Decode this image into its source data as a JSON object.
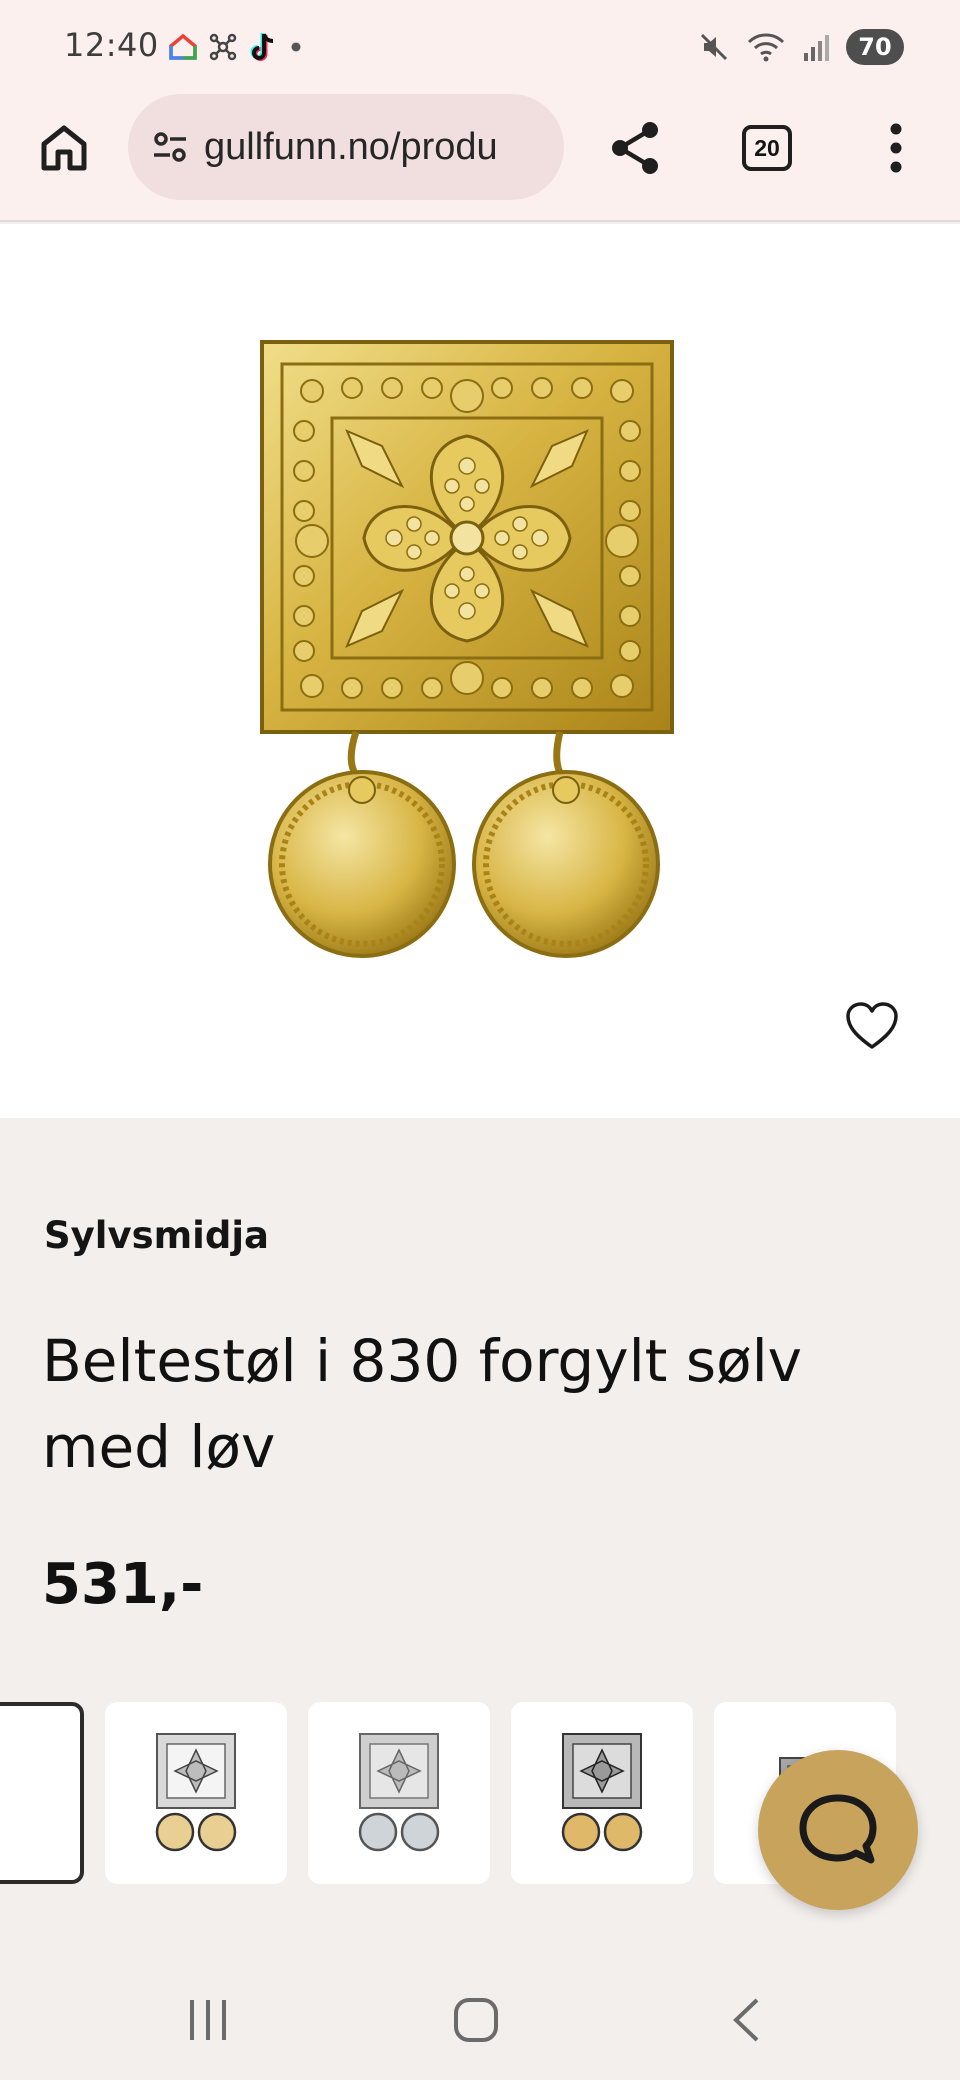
{
  "status_bar": {
    "time": "12:40",
    "battery": "70",
    "icons_left": [
      "google-home-icon",
      "network-icon",
      "tiktok-icon",
      "dot-icon"
    ],
    "icons_right": [
      "mute-icon",
      "wifi-icon",
      "signal-icon"
    ]
  },
  "browser": {
    "url": "gullfunn.no/produ",
    "tab_count": "20",
    "icons": [
      "home-icon",
      "site-settings-icon",
      "share-icon",
      "tabs-icon",
      "menu-icon"
    ]
  },
  "product": {
    "brand": "Sylvsmidja",
    "title": "Beltestøl i 830 forgylt sølv med løv",
    "price": "531,-",
    "image_colors": {
      "gold": "#d9b94a",
      "gold_dark": "#8b6d12",
      "gold_light": "#f3e3a0"
    }
  },
  "variants": [
    {
      "name": "selected-variant",
      "metal": "gold"
    },
    {
      "name": "variant-silver-gold-drops",
      "metal": "silver-gold"
    },
    {
      "name": "variant-silver",
      "metal": "silver"
    },
    {
      "name": "variant-oxidized-gold-drops",
      "metal": "oxidized-gold"
    },
    {
      "name": "variant-oxidized",
      "metal": "oxidized"
    }
  ],
  "colors": {
    "chrome_bg": "#fcf0ef",
    "url_pill": "#f1dfdf",
    "page_bg": "#f2efed",
    "chat_accent": "#c8a35b"
  }
}
